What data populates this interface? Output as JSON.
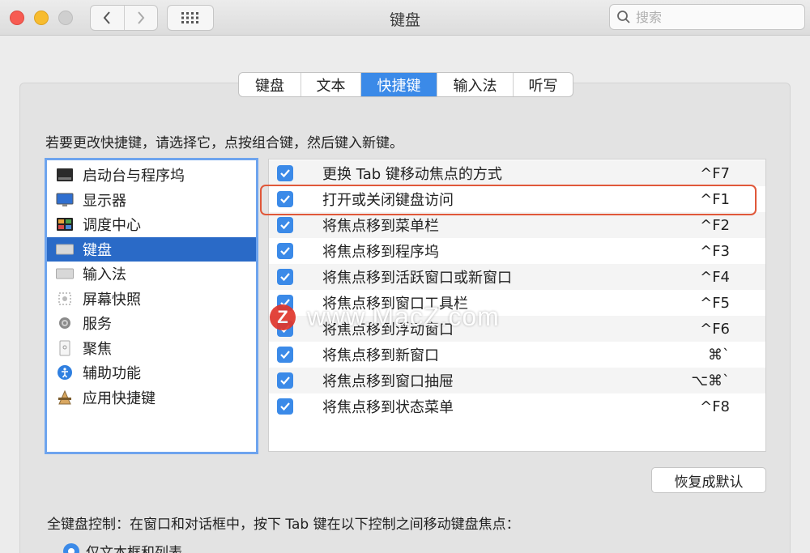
{
  "window": {
    "title": "键盘",
    "search_placeholder": "搜索"
  },
  "tabs": [
    {
      "label": "键盘",
      "active": false
    },
    {
      "label": "文本",
      "active": false
    },
    {
      "label": "快捷键",
      "active": true
    },
    {
      "label": "输入法",
      "active": false
    },
    {
      "label": "听写",
      "active": false
    }
  ],
  "instruction": "若要更改快捷键，请选择它，点按组合键，然后键入新键。",
  "categories": [
    {
      "label": "启动台与程序坞",
      "icon": "launchpad-dock-icon",
      "selected": false
    },
    {
      "label": "显示器",
      "icon": "display-icon",
      "selected": false
    },
    {
      "label": "调度中心",
      "icon": "mission-control-icon",
      "selected": false
    },
    {
      "label": "键盘",
      "icon": "keyboard-icon",
      "selected": true
    },
    {
      "label": "输入法",
      "icon": "input-source-icon",
      "selected": false
    },
    {
      "label": "屏幕快照",
      "icon": "screenshot-icon",
      "selected": false
    },
    {
      "label": "服务",
      "icon": "gear-icon",
      "selected": false
    },
    {
      "label": "聚焦",
      "icon": "spotlight-icon",
      "selected": false
    },
    {
      "label": "辅助功能",
      "icon": "accessibility-icon",
      "selected": false
    },
    {
      "label": "应用快捷键",
      "icon": "app-shortcuts-icon",
      "selected": false
    }
  ],
  "shortcuts": [
    {
      "label": "更换 Tab 键移动焦点的方式",
      "key": "^F7",
      "checked": true
    },
    {
      "label": "打开或关闭键盘访问",
      "key": "^F1",
      "checked": true
    },
    {
      "label": "将焦点移到菜单栏",
      "key": "^F2",
      "checked": true
    },
    {
      "label": "将焦点移到程序坞",
      "key": "^F3",
      "checked": true
    },
    {
      "label": "将焦点移到活跃窗口或新窗口",
      "key": "^F4",
      "checked": true
    },
    {
      "label": "将焦点移到窗口工具栏",
      "key": "^F5",
      "checked": true
    },
    {
      "label": "将焦点移到浮动窗口",
      "key": "^F6",
      "checked": true
    },
    {
      "label": "将焦点移到新窗口",
      "key": "⌘`",
      "checked": true
    },
    {
      "label": "将焦点移到窗口抽屉",
      "key": "⌥⌘`",
      "checked": true
    },
    {
      "label": "将焦点移到状态菜单",
      "key": "^F8",
      "checked": true
    }
  ],
  "restore_defaults": "恢复成默认",
  "full_keyboard_access": "全键盘控制：在窗口和对话框中，按下 Tab 键在以下控制之间移动键盘焦点：",
  "radio_option": "仅文本框和列表",
  "watermark": "www.MacZ.com",
  "colors": {
    "accent": "#3b8ae8",
    "selection": "#2a6ac7",
    "highlight_box": "#e0583a"
  }
}
